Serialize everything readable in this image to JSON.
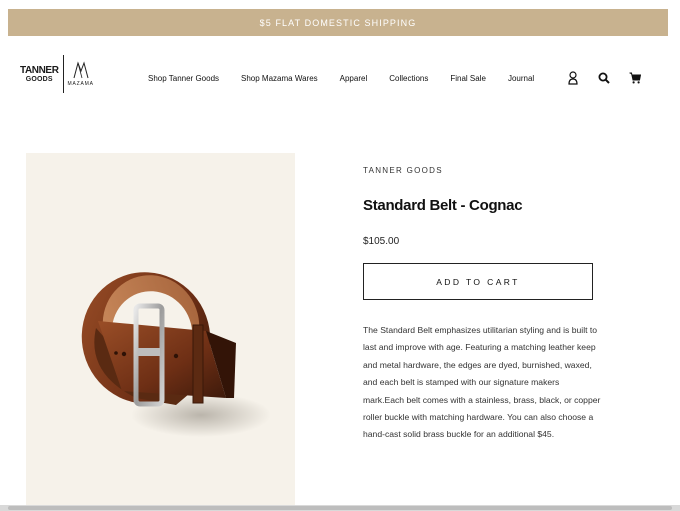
{
  "announcement": "$5 FLAT DOMESTIC SHIPPING",
  "logo": {
    "primary_line1": "TANNER",
    "primary_line2": "GOODS",
    "secondary": "MAZAMA"
  },
  "nav": {
    "items": [
      "Shop Tanner Goods",
      "Shop Mazama Wares",
      "Apparel",
      "Collections",
      "Final Sale",
      "Journal"
    ]
  },
  "header_icons": [
    "user-icon",
    "search-icon",
    "cart-icon"
  ],
  "product": {
    "vendor": "TANNER GOODS",
    "title": "Standard Belt - Cognac",
    "price": "$105.00",
    "add_to_cart": "ADD TO CART",
    "description": "The Standard Belt emphasizes utilitarian styling and is built to last and improve with age. Featuring a matching leather keep and metal hardware, the edges are dyed, burnished, waxed, and each belt is stamped with our signature makers mark.Each belt comes with a stainless, brass, black, or copper roller buckle with matching hardware. You can also choose a hand-cast solid brass buckle for an additional $45."
  },
  "colors": {
    "announcement_bg": "#c8b28f",
    "image_bg": "#f6f2ea",
    "leather": "#7a3a1c"
  }
}
